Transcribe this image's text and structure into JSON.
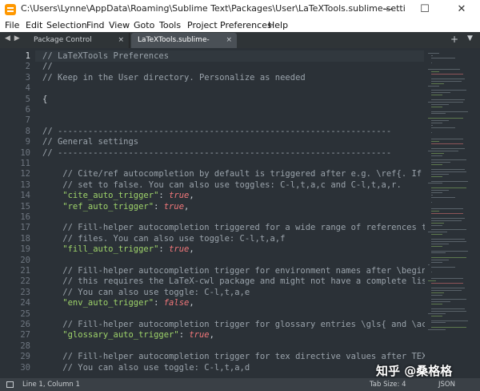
{
  "window": {
    "title": "C:\\Users\\Lynne\\AppData\\Roaming\\Sublime Text\\Packages\\User\\LaTeXTools.sublime-settings - Sublime Te...",
    "minimize": "—",
    "maximize": "☐",
    "close": "✕"
  },
  "menu": [
    "File",
    "Edit",
    "Selection",
    "Find",
    "View",
    "Goto",
    "Tools",
    "Project",
    "Preferences",
    "Help"
  ],
  "tabs": [
    {
      "label": "Package Control Messages",
      "close": "×",
      "active": false
    },
    {
      "label": "LaTeXTools.sublime-settings",
      "close": "×",
      "active": true
    }
  ],
  "tabbar": {
    "nav": "◀ ▶",
    "add": "+",
    "menu": "▼"
  },
  "editor": {
    "lines": [
      {
        "n": "1",
        "parts": [
          {
            "t": "// LaTeXTools Preferences",
            "c": "c-comment"
          }
        ]
      },
      {
        "n": "2",
        "parts": [
          {
            "t": "//",
            "c": "c-comment"
          }
        ]
      },
      {
        "n": "3",
        "parts": [
          {
            "t": "// Keep in the User directory. Personalize as needed",
            "c": "c-comment"
          }
        ]
      },
      {
        "n": "4",
        "parts": []
      },
      {
        "n": "5",
        "parts": [
          {
            "t": "{",
            "c": "c-punc"
          }
        ]
      },
      {
        "n": "6",
        "parts": []
      },
      {
        "n": "7",
        "parts": []
      },
      {
        "n": "8",
        "parts": [
          {
            "t": "// ------------------------------------------------------------------",
            "c": "c-comment"
          }
        ]
      },
      {
        "n": "9",
        "parts": [
          {
            "t": "// General settings",
            "c": "c-comment"
          }
        ]
      },
      {
        "n": "10",
        "parts": [
          {
            "t": "// ------------------------------------------------------------------",
            "c": "c-comment"
          }
        ]
      },
      {
        "n": "11",
        "parts": []
      },
      {
        "n": "12",
        "parts": [
          {
            "t": "    // Cite/ref autocompletion by default is triggered after e.g. \\ref{. If you",
            "c": "c-comment"
          }
        ]
      },
      {
        "n": "13",
        "parts": [
          {
            "t": "    // set to false. You can also use toggles: C-l,t,a,c and C-l,t,a,r.",
            "c": "c-comment"
          }
        ]
      },
      {
        "n": "14",
        "parts": [
          {
            "t": "    \"cite_auto_trigger\"",
            "c": "c-str"
          },
          {
            "t": ": ",
            "c": "c-punc"
          },
          {
            "t": "true",
            "c": "c-bool"
          },
          {
            "t": ",",
            "c": "c-punc"
          }
        ]
      },
      {
        "n": "15",
        "parts": [
          {
            "t": "    \"ref_auto_trigger\"",
            "c": "c-str"
          },
          {
            "t": ": ",
            "c": "c-punc"
          },
          {
            "t": "true",
            "c": "c-bool"
          },
          {
            "t": ",",
            "c": "c-punc"
          }
        ]
      },
      {
        "n": "16",
        "parts": []
      },
      {
        "n": "17",
        "parts": [
          {
            "t": "    // Fill-helper autocompletion triggered for a wide range of references to",
            "c": "c-comment"
          }
        ]
      },
      {
        "n": "18",
        "parts": [
          {
            "t": "    // files. You can also use toggle: C-l,t,a,f",
            "c": "c-comment"
          }
        ]
      },
      {
        "n": "19",
        "parts": [
          {
            "t": "    \"fill_auto_trigger\"",
            "c": "c-str"
          },
          {
            "t": ": ",
            "c": "c-punc"
          },
          {
            "t": "true",
            "c": "c-bool"
          },
          {
            "t": ",",
            "c": "c-punc"
          }
        ]
      },
      {
        "n": "20",
        "parts": []
      },
      {
        "n": "21",
        "parts": [
          {
            "t": "    // Fill-helper autocompletion trigger for environment names after \\begin{",
            "c": "c-comment"
          }
        ]
      },
      {
        "n": "22",
        "parts": [
          {
            "t": "    // this requires the LaTeX-cwl package and might not have a complete list",
            "c": "c-comment"
          }
        ]
      },
      {
        "n": "23",
        "parts": [
          {
            "t": "    // You can also use toggle: C-l,t,a,e",
            "c": "c-comment"
          }
        ]
      },
      {
        "n": "24",
        "parts": [
          {
            "t": "    \"env_auto_trigger\"",
            "c": "c-str"
          },
          {
            "t": ": ",
            "c": "c-punc"
          },
          {
            "t": "false",
            "c": "c-bool"
          },
          {
            "t": ",",
            "c": "c-punc"
          }
        ]
      },
      {
        "n": "25",
        "parts": []
      },
      {
        "n": "26",
        "parts": [
          {
            "t": "    // Fill-helper autocompletion trigger for glossary entries \\gls{ and \\acrf",
            "c": "c-comment"
          }
        ]
      },
      {
        "n": "27",
        "parts": [
          {
            "t": "    \"glossary_auto_trigger\"",
            "c": "c-str"
          },
          {
            "t": ": ",
            "c": "c-punc"
          },
          {
            "t": "true",
            "c": "c-bool"
          },
          {
            "t": ",",
            "c": "c-punc"
          }
        ]
      },
      {
        "n": "28",
        "parts": []
      },
      {
        "n": "29",
        "parts": [
          {
            "t": "    // Fill-helper autocompletion trigger for tex directive values after TEX d",
            "c": "c-comment"
          }
        ]
      },
      {
        "n": "30",
        "parts": [
          {
            "t": "    // You can also use toggle: C-l,t,a,d",
            "c": "c-comment"
          }
        ]
      }
    ]
  },
  "status": {
    "position": "Line 1, Column 1",
    "tab_size": "Tab Size: 4",
    "syntax": "JSON"
  },
  "watermark": "知乎 @桑格格"
}
